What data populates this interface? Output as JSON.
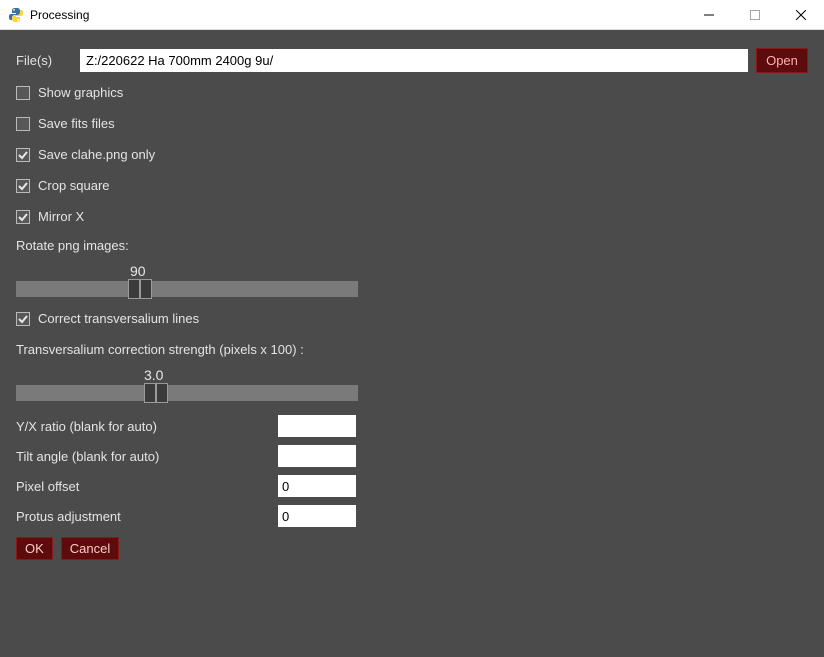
{
  "window": {
    "title": "Processing"
  },
  "files": {
    "label": "File(s)",
    "value": "Z:/220622 Ha 700mm 2400g 9u/",
    "open_label": "Open"
  },
  "checkboxes": {
    "show_graphics": {
      "label": "Show graphics",
      "checked": false
    },
    "save_fits": {
      "label": "Save fits files",
      "checked": false
    },
    "save_clahe": {
      "label": "Save clahe.png only",
      "checked": true
    },
    "crop_square": {
      "label": "Crop square",
      "checked": true
    },
    "mirror_x": {
      "label": "Mirror X",
      "checked": true
    },
    "correct_trans": {
      "label": "Correct transversalium lines",
      "checked": true
    }
  },
  "rotate": {
    "label": "Rotate png images:",
    "value": "90"
  },
  "trans_strength": {
    "label": "Transversalium correction strength (pixels x 100) :",
    "value": "3.0"
  },
  "fields": {
    "yx_ratio": {
      "label": "Y/X ratio (blank for auto)",
      "value": ""
    },
    "tilt": {
      "label": "Tilt angle (blank for auto)",
      "value": ""
    },
    "pixel_offset": {
      "label": "Pixel offset",
      "value": "0"
    },
    "protus": {
      "label": "Protus adjustment",
      "value": "0"
    }
  },
  "buttons": {
    "ok": "OK",
    "cancel": "Cancel"
  }
}
